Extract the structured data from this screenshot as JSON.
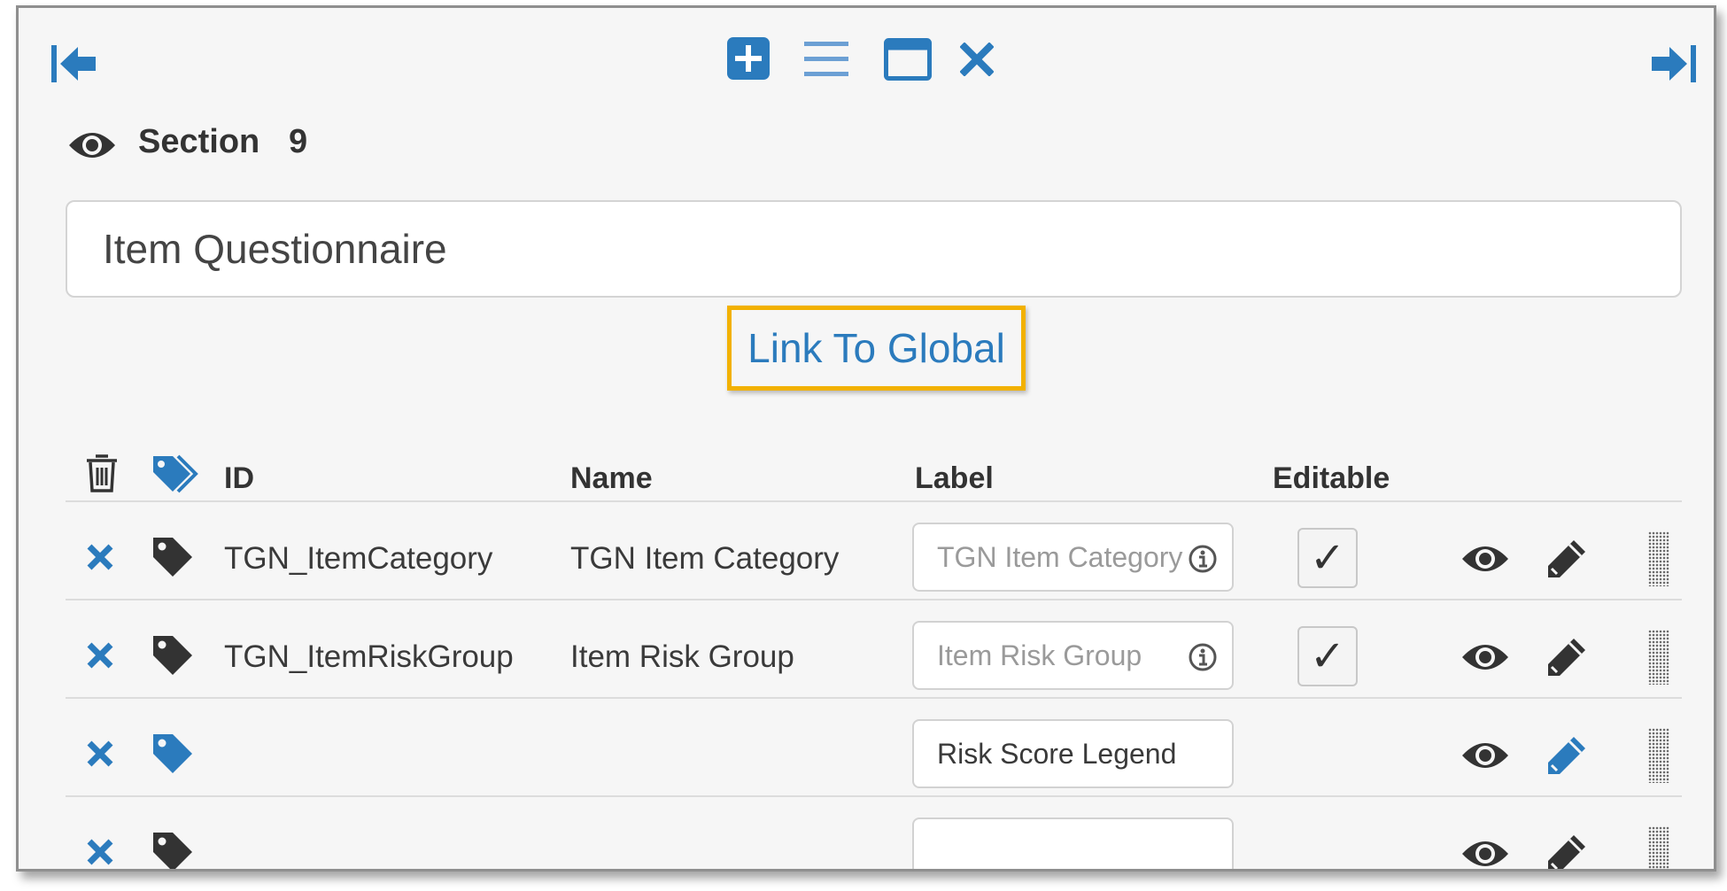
{
  "toolbar": {
    "icons": [
      "collapse-left-icon",
      "add-icon",
      "list-icon",
      "window-icon",
      "close-icon",
      "expand-right-icon"
    ]
  },
  "section": {
    "label": "Section",
    "number": "9",
    "title_value": "Item Questionnaire"
  },
  "link_to_global": "Link To Global",
  "table": {
    "headers": {
      "id": "ID",
      "name": "Name",
      "label": "Label",
      "editable": "Editable"
    },
    "rows": [
      {
        "id": "TGN_ItemCategory",
        "name": "TGN Item Category",
        "label_placeholder": "TGN Item Category",
        "label_value": "",
        "editable": "✓"
      },
      {
        "id": "TGN_ItemRiskGroup",
        "name": "Item Risk Group",
        "label_placeholder": "Item Risk Group",
        "label_value": "",
        "editable": "✓"
      },
      {
        "id": "",
        "name": "",
        "label_placeholder": "",
        "label_value": "Risk Score Legend",
        "editable": ""
      },
      {
        "id": "",
        "name": "",
        "label_placeholder": "",
        "label_value": "",
        "editable": ""
      }
    ]
  },
  "colors": {
    "accent_blue": "#2b7bbd",
    "dark_icon": "#333333",
    "highlight_border": "#f2b100"
  }
}
